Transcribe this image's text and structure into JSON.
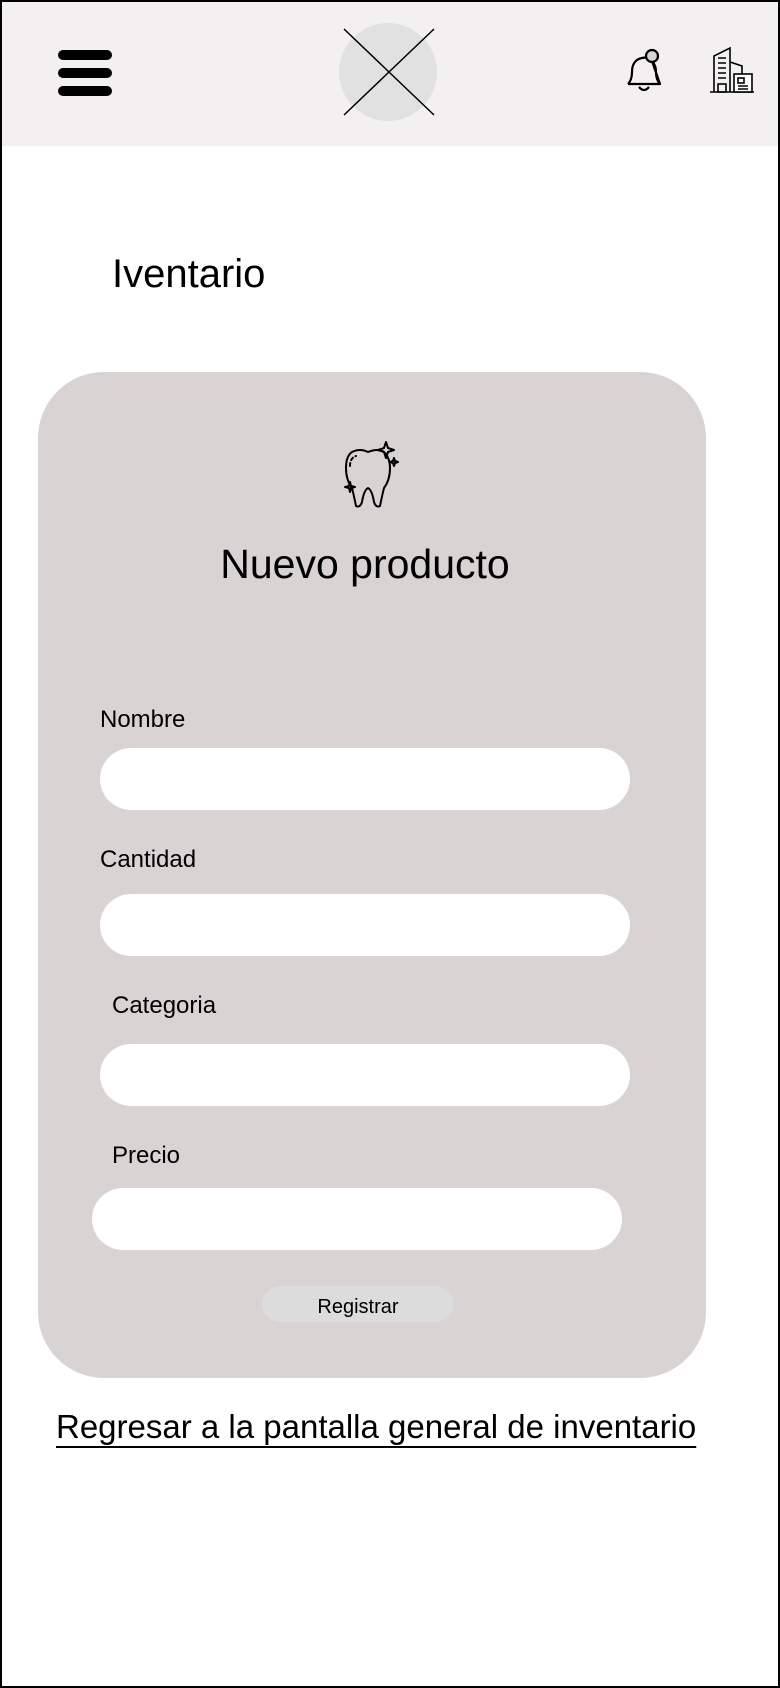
{
  "header": {
    "menu_icon": "hamburger-menu-icon",
    "logo_icon": "image-placeholder-logo",
    "notifications_icon": "bell-icon",
    "building_icon": "building-icon"
  },
  "page": {
    "title": "Iventario"
  },
  "form": {
    "icon": "tooth-icon",
    "title": "Nuevo producto",
    "fields": [
      {
        "label": "Nombre",
        "value": "",
        "placeholder": ""
      },
      {
        "label": "Cantidad",
        "value": "",
        "placeholder": ""
      },
      {
        "label": "Categoria",
        "value": "",
        "placeholder": ""
      },
      {
        "label": "Precio",
        "value": "",
        "placeholder": ""
      }
    ],
    "submit_label": "Registrar"
  },
  "back_link": {
    "label": "Regresar a la pantalla general de inventario"
  },
  "colors": {
    "header_bg": "#f2f0f1",
    "card_bg": "#d9d3d4",
    "input_bg": "#ffffff",
    "button_bg": "#dcdcdc"
  }
}
